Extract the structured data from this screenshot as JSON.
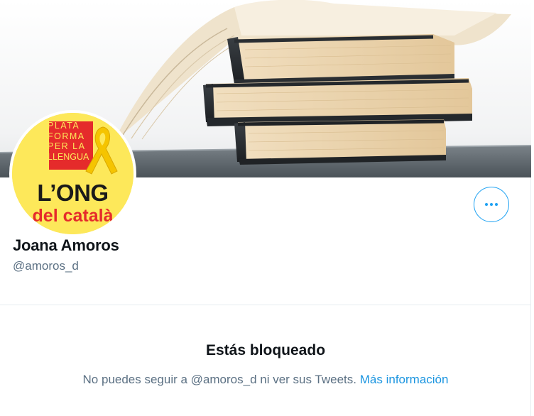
{
  "profile": {
    "display_name": "Joana Amoros",
    "handle": "@amoros_d"
  },
  "avatar_logo": {
    "lines": [
      "PLATA",
      "FORMA",
      "PER LA",
      "LLENGUA"
    ],
    "big_text": "L’ONG",
    "sub_text": "del català"
  },
  "actions": {
    "more_icon": "more-horizontal-icon"
  },
  "blocked": {
    "title": "Estás bloqueado",
    "message": "No puedes seguir a @amoros_d ni ver sus Tweets.",
    "link": "Más información"
  },
  "colors": {
    "accent": "#1da1f2",
    "link": "#1b95e0",
    "secondary_text": "#5b7083",
    "logo_yellow": "#fde85a",
    "logo_red": "#e52b2b"
  }
}
